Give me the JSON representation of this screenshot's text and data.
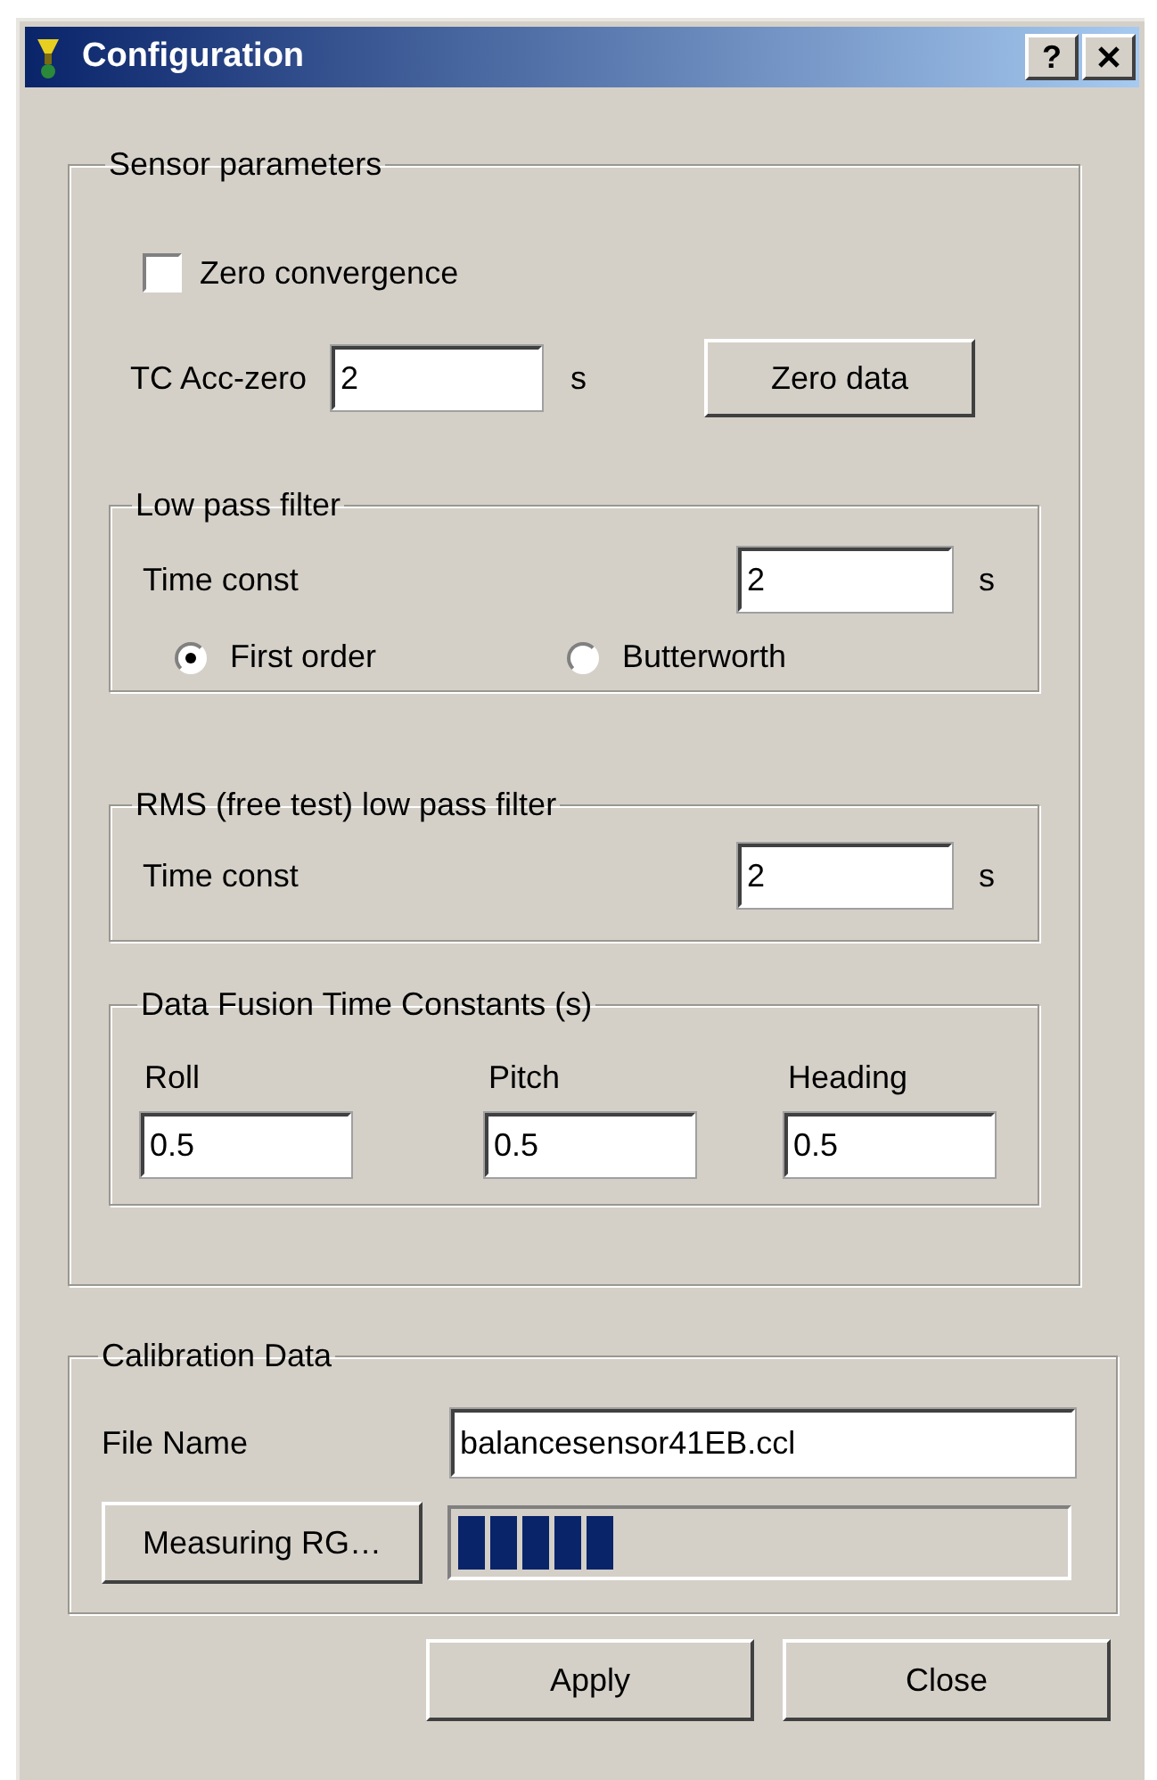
{
  "window": {
    "title": "Configuration",
    "help_button": "?"
  },
  "sensor_parameters": {
    "title": "Sensor parameters",
    "zero_convergence": {
      "label": "Zero convergence",
      "checked": false
    },
    "tc_acc_zero": {
      "label": "TC Acc-zero",
      "value": "2",
      "unit": "s"
    },
    "zero_data_button": "Zero data",
    "low_pass_filter": {
      "title": "Low pass filter",
      "time_const": {
        "label": "Time const",
        "value": "2",
        "unit": "s"
      },
      "filter_order": [
        {
          "label": "First order",
          "selected": true
        },
        {
          "label": "Butterworth",
          "selected": false
        }
      ]
    },
    "rms_filter": {
      "title": "RMS (free test) low pass filter",
      "time_const": {
        "label": "Time const",
        "value": "2",
        "unit": "s"
      }
    },
    "data_fusion": {
      "title": "Data Fusion Time Constants (s)",
      "fields": [
        {
          "label": "Roll",
          "value": "0.5"
        },
        {
          "label": "Pitch",
          "value": "0.5"
        },
        {
          "label": "Heading",
          "value": "0.5"
        }
      ]
    }
  },
  "calibration": {
    "title": "Calibration Data",
    "file_name": {
      "label": "File Name",
      "value": "balancesensor41EB.ccl"
    },
    "measure_button": "Measuring RG…",
    "progress": {
      "level": 0.26
    }
  },
  "buttons": [
    "Apply",
    "Close"
  ]
}
